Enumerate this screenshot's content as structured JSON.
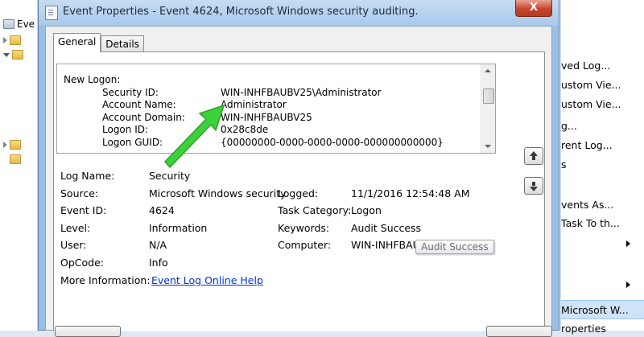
{
  "background_left": {
    "item_prefix": "Eve"
  },
  "background_right": {
    "actions": [
      "ved Log...",
      "ustom Vie...",
      "ustom Vie...",
      "g...",
      "rent Log...",
      "s",
      "vents As...",
      "Task To th...",
      "",
      "",
      "Microsoft W...",
      "roperties"
    ]
  },
  "dialog": {
    "title": "Event Properties - Event 4624, Microsoft Windows security auditing.",
    "close_glyph": "X",
    "tabs": [
      {
        "label": "General"
      },
      {
        "label": "Details"
      }
    ],
    "description": {
      "header": "New Logon:",
      "lines": [
        {
          "key": "Security ID:",
          "value": "WIN-INHFBAUBV25\\Administrator"
        },
        {
          "key": "Account Name:",
          "value": "Administrator"
        },
        {
          "key": "Account Domain:",
          "value": "WIN-INHFBAUBV25"
        },
        {
          "key": "Logon ID:",
          "value": "0x28c8de"
        },
        {
          "key": "Logon GUID:",
          "value": "{00000000-0000-0000-0000-000000000000}"
        }
      ]
    },
    "fields": {
      "log_name": {
        "label": "Log Name:",
        "value": "Security"
      },
      "source": {
        "label": "Source:",
        "value": "Microsoft Windows security"
      },
      "logged": {
        "label": "Logged:",
        "value": "11/1/2016 12:54:48 AM"
      },
      "event_id": {
        "label": "Event ID:",
        "value": "4624"
      },
      "task_category": {
        "label": "Task Category:",
        "value": "Logon"
      },
      "level": {
        "label": "Level:",
        "value": "Information"
      },
      "keywords": {
        "label": "Keywords:",
        "value": "Audit Success"
      },
      "user": {
        "label": "User:",
        "value": "N/A"
      },
      "computer": {
        "label": "Computer:",
        "value": "WIN-INHFBAUBV25"
      },
      "opcode": {
        "label": "OpCode:",
        "value": "Info"
      },
      "more_info": {
        "label": "More Information:",
        "link": "Event Log Online Help"
      }
    },
    "tooltip": "Audit Success"
  },
  "colors": {
    "title_bar": "#a9c8ea",
    "close_button": "#c7452d",
    "link": "#0033cc",
    "annotation_arrow": "#3ed23a"
  }
}
